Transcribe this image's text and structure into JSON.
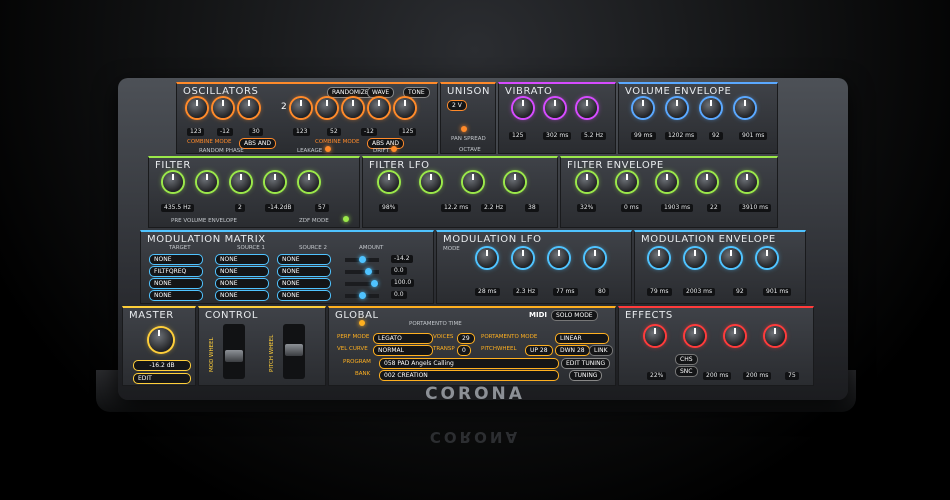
{
  "brand": {
    "logo": "CORONA"
  },
  "oscillators": {
    "title": "OSCILLATORS",
    "header_chip_1": "RANDOMIZE",
    "header_chip_2": "WAVE",
    "header_chip_3": "TONE",
    "values": [
      "123",
      "-12",
      "30",
      "123",
      "52",
      "-12",
      "125"
    ],
    "combine_mode_label": "COMBINE MODE",
    "combine_mode_value_1": "ABS AND",
    "combine_mode_value_2": "ABS AND",
    "random_phase": "RANDOM PHASE",
    "leakage": "LEAKAGE",
    "drift": "DRIFT",
    "number_2": "2"
  },
  "unison": {
    "title": "UNISON",
    "pan_spread": "PAN SPREAD",
    "octave": "OCTAVE"
  },
  "vibrato": {
    "title": "VIBRATO",
    "values": [
      "125",
      "302 ms",
      "5.2 Hz"
    ]
  },
  "volume_envelope": {
    "title": "VOLUME ENVELOPE",
    "values": [
      "99 ms",
      "1202 ms",
      "92",
      "901 ms"
    ]
  },
  "filter": {
    "title": "FILTER",
    "values": [
      "435.5 Hz",
      "2",
      "-14.2dB",
      "57"
    ],
    "pre_volume": "PRE VOLUME ENVELOPE",
    "zdf_mode": "ZDF MODE"
  },
  "filter_lfo": {
    "title": "FILTER LFO",
    "values": [
      "98%",
      "12.2 ms",
      "2.2 Hz",
      "38"
    ]
  },
  "filter_envelope": {
    "title": "FILTER ENVELOPE",
    "values": [
      "32%",
      "0 ms",
      "1903 ms",
      "22",
      "3910 ms"
    ]
  },
  "mod_matrix": {
    "title": "MODULATION MATRIX",
    "col_target": "TARGET",
    "col_source1": "SOURCE 1",
    "col_source2": "SOURCE 2",
    "col_amount": "AMOUNT",
    "rows": [
      {
        "target": "NONE",
        "source1": "NONE",
        "source2": "NONE",
        "amount": "-14.2"
      },
      {
        "target": "FILTFQREQ",
        "source1": "NONE",
        "source2": "NONE",
        "amount": "0.0"
      },
      {
        "target": "NONE",
        "source1": "NONE",
        "source2": "NONE",
        "amount": "100.0"
      },
      {
        "target": "NONE",
        "source1": "NONE",
        "source2": "NONE",
        "amount": "0.0"
      }
    ]
  },
  "mod_lfo": {
    "title": "MODULATION LFO",
    "mode": "MODE",
    "values": [
      "28 ms",
      "2.3 Hz",
      "77 ms",
      "80"
    ]
  },
  "mod_envelope": {
    "title": "MODULATION ENVELOPE",
    "values": [
      "79 ms",
      "2003 ms",
      "92",
      "901 ms"
    ]
  },
  "master": {
    "title": "MASTER",
    "value": "-16.2 dB",
    "edit": "EDIT"
  },
  "control": {
    "title": "CONTROL",
    "mod_wheel": "MOD WHEEL",
    "pitch_wheel": "PITCH WHEEL"
  },
  "global": {
    "title": "GLOBAL",
    "portamento_time": "PORTAMENTO TIME",
    "midi": "MIDI",
    "solo_mode": "SOLO MODE",
    "perf_mode_label": "PERF MODE",
    "perf_mode_value": "LEGATO",
    "voices_label": "VOICES",
    "voices_value": "29",
    "portamento_mode_label": "PORTAMENTO MODE",
    "portamento_mode_value": "LINEAR",
    "vel_curve_label": "VEL CURVE",
    "vel_curve_value": "NORMAL",
    "transp_label": "TRANSP",
    "transp_value": "0",
    "pitchwheel_label": "PITCHWHEEL",
    "pitch_up": "UP 28",
    "pitch_down": "DWN 28",
    "link": "LINK",
    "program_label": "PROGRAM",
    "program_value": "058 PAD Angels Calling",
    "bank_label": "BANK",
    "bank_value": "002 CREATION",
    "edit_tuning": "EDIT TUNING",
    "tuning": "TUNING"
  },
  "effects": {
    "title": "EFFECTS",
    "values": [
      "22%",
      "200 ms",
      "200 ms",
      "75"
    ],
    "chip_1": "CHS",
    "chip_2": "SNC"
  },
  "colors": {
    "oscillators": "#ff8a2a",
    "vibrato": "#d64bff",
    "volume_envelope": "#5aa8ff",
    "filter": "#9be84a",
    "mod": "#4fc3ff",
    "master": "#ffcf3a",
    "global": "#ffb020",
    "effects": "#ff3b3b"
  }
}
